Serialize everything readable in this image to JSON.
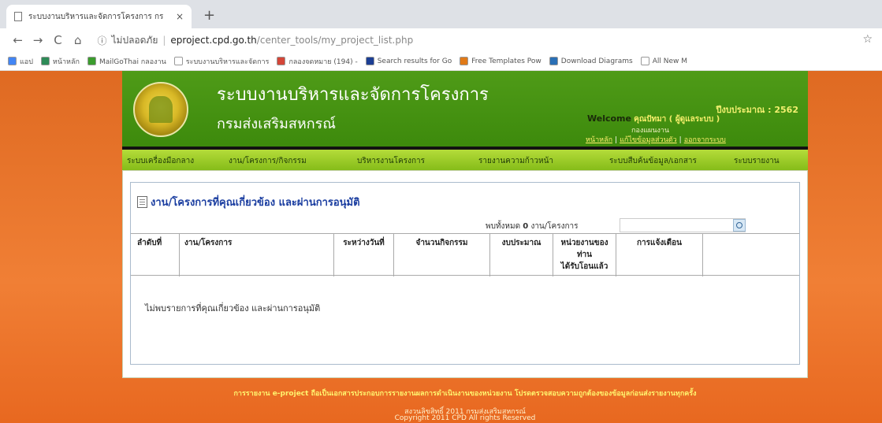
{
  "browser": {
    "tab_title": "ระบบงานบริหารและจัดการโครงการ กร",
    "tab_close": "×",
    "new_tab": "+",
    "nav_back": "←",
    "nav_forward": "→",
    "nav_reload": "C",
    "nav_home": "⌂",
    "security_text": "ไม่ปลอดภัย",
    "address_host": "eproject.cpd.go.th",
    "address_path": "/center_tools/my_project_list.php",
    "star": "☆",
    "bookmarks": [
      {
        "label": "แอป",
        "color": "#4285f4"
      },
      {
        "label": "หน้าหลัก",
        "color": "#2e8b57"
      },
      {
        "label": "MailGoThai กลองาน",
        "color": "#3b9c2d"
      },
      {
        "label": "ระบบงานบริหารและจัดการ",
        "color": "#ffffff"
      },
      {
        "label": "กลองจดหมาย (194) -",
        "color": "#d44638"
      },
      {
        "label": "Search results for Go",
        "color": "#1c3f94"
      },
      {
        "label": "Free Templates Pow",
        "color": "#e07a18"
      },
      {
        "label": "Download Diagrams",
        "color": "#2a6fb5"
      },
      {
        "label": "All New M",
        "color": "#ffffff"
      }
    ]
  },
  "header": {
    "title_line1": "ระบบงานบริหารและจัดการโครงการ",
    "title_line2": "กรมส่งเสริมสหกรณ์",
    "fiscal_year": "ปีงบประมาณ : 2562",
    "welcome_label": "Welcome",
    "welcome_name": "คุณปัทมา ( ผู้ดูแลระบบ )",
    "department": "กองแผนงาน",
    "link_home": "หน้าหลัก",
    "link_edit": "แก้ไขข้อมูลส่วนตัว",
    "link_logout": "ออกจากระบบ",
    "link_sep": "|"
  },
  "menu": [
    "ระบบเครื่องมือกลาง",
    "งาน/โครงการ/กิจกรรม",
    "บริหารงานโครงการ",
    "รายงานความก้าวหน้า",
    "ระบบสืบค้นข้อมูล/เอกสาร",
    "ระบบรายงาน"
  ],
  "panel": {
    "title": "งาน/โครงการที่คุณเกี่ยวข้อง และผ่านการอนุมัติ",
    "found_prefix": "พบทั้งหมด",
    "found_count": "0",
    "found_suffix": "งาน/โครงการ",
    "search_value": ""
  },
  "table": {
    "headers": [
      "ลำดับที่",
      "งาน/โครงการ",
      "ระหว่างวันที่",
      "จำนวนกิจกรรม",
      "งบประมาณ",
      [
        "หน่วยงานของ",
        "ท่าน",
        "ได้รับโอนแล้ว"
      ],
      "การแจ้งเตือน"
    ],
    "empty_message": "ไม่พบรายการที่คุณเกี่ยวข้อง และผ่านการอนุมัติ"
  },
  "footer": {
    "note": "การรายงาน e-project ถือเป็นเอกสารประกอบการรายงานผลการดำเนินงานของหน่วยงาน โปรดตรวจสอบความถูกต้องของข้อมูลก่อนส่งรายงานทุกครั้ง",
    "copyright_th": "สงวนลิขสิทธิ์ 2011 กรมส่งเสริมสหกรณ์",
    "copyright_en": "Copyright 2011 CPD All rights Reserved"
  }
}
